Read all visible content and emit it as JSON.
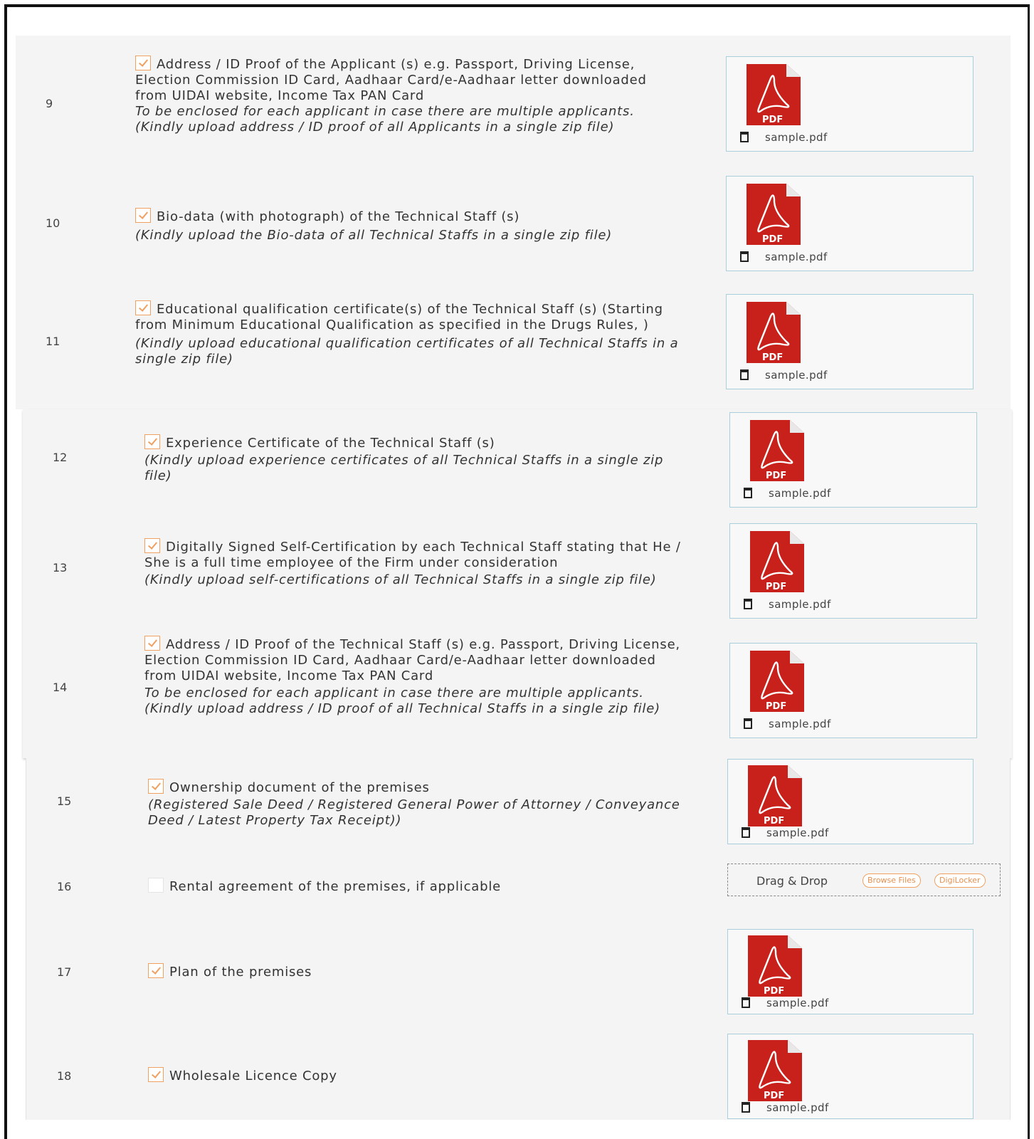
{
  "rows": [
    {
      "num": "9",
      "checked": true,
      "main": "Address / ID Proof of the Applicant (s) e.g. Passport, Driving License, Election Commission ID Card, Aadhaar Card/e-Aadhaar letter downloaded from UIDAI website, Income Tax PAN Card",
      "note": "To be enclosed for each applicant in case there are multiple applicants.",
      "note2": "(Kindly upload address / ID proof of all Applicants in a single zip file)",
      "file": "sample.pdf"
    },
    {
      "num": "10",
      "checked": true,
      "main": "Bio-data (with photograph) of the Technical Staff (s)",
      "note": "(Kindly upload the Bio-data of all Technical Staffs in a single zip file)",
      "file": "sample.pdf"
    },
    {
      "num": "11",
      "checked": true,
      "main": "Educational qualification certificate(s) of the Technical Staff (s) (Starting from Minimum Educational Qualification as specified in the Drugs Rules, )",
      "note": "(Kindly upload educational qualification certificates of all Technical Staffs in a single zip file)",
      "file": "sample.pdf"
    },
    {
      "num": "12",
      "checked": true,
      "main": "Experience Certificate of the Technical Staff (s)",
      "note": "(Kindly upload experience certificates of all Technical Staffs in a single zip file)",
      "file": "sample.pdf"
    },
    {
      "num": "13",
      "checked": true,
      "main": "Digitally Signed Self-Certification by each Technical Staff stating that He / She is a full time employee of the Firm under consideration",
      "note": "(Kindly upload self-certifications of all Technical Staffs in a single zip file)",
      "file": "sample.pdf"
    },
    {
      "num": "14",
      "checked": true,
      "main": "Address / ID Proof of the Technical Staff (s) e.g. Passport, Driving License, Election Commission ID Card, Aadhaar Card/e-Aadhaar letter downloaded from UIDAI website, Income Tax PAN Card",
      "note": "To be enclosed for each applicant in case there are multiple applicants.",
      "note2": "(Kindly upload address / ID proof of all Technical Staffs in a single zip file)",
      "file": "sample.pdf"
    },
    {
      "num": "15",
      "checked": true,
      "main": "Ownership document of the premises",
      "note": "(Registered Sale Deed / Registered General Power of Attorney / Conveyance Deed / Latest Property Tax Receipt))",
      "file": "sample.pdf"
    },
    {
      "num": "16",
      "checked": false,
      "main": "Rental agreement of the premises, if applicable"
    },
    {
      "num": "17",
      "checked": true,
      "main": "Plan of the premises",
      "file": "sample.pdf"
    },
    {
      "num": "18",
      "checked": true,
      "main": "Wholesale Licence Copy",
      "file": "sample.pdf"
    }
  ],
  "pdf_icon_label": "PDF",
  "dropzone": {
    "text": "Drag & Drop",
    "browse": "Browse Files",
    "digilocker": "DigiLocker"
  },
  "colors": {
    "accent": "#f0a060",
    "pdf_red": "#c8201a",
    "file_border": "#a8cfda"
  }
}
